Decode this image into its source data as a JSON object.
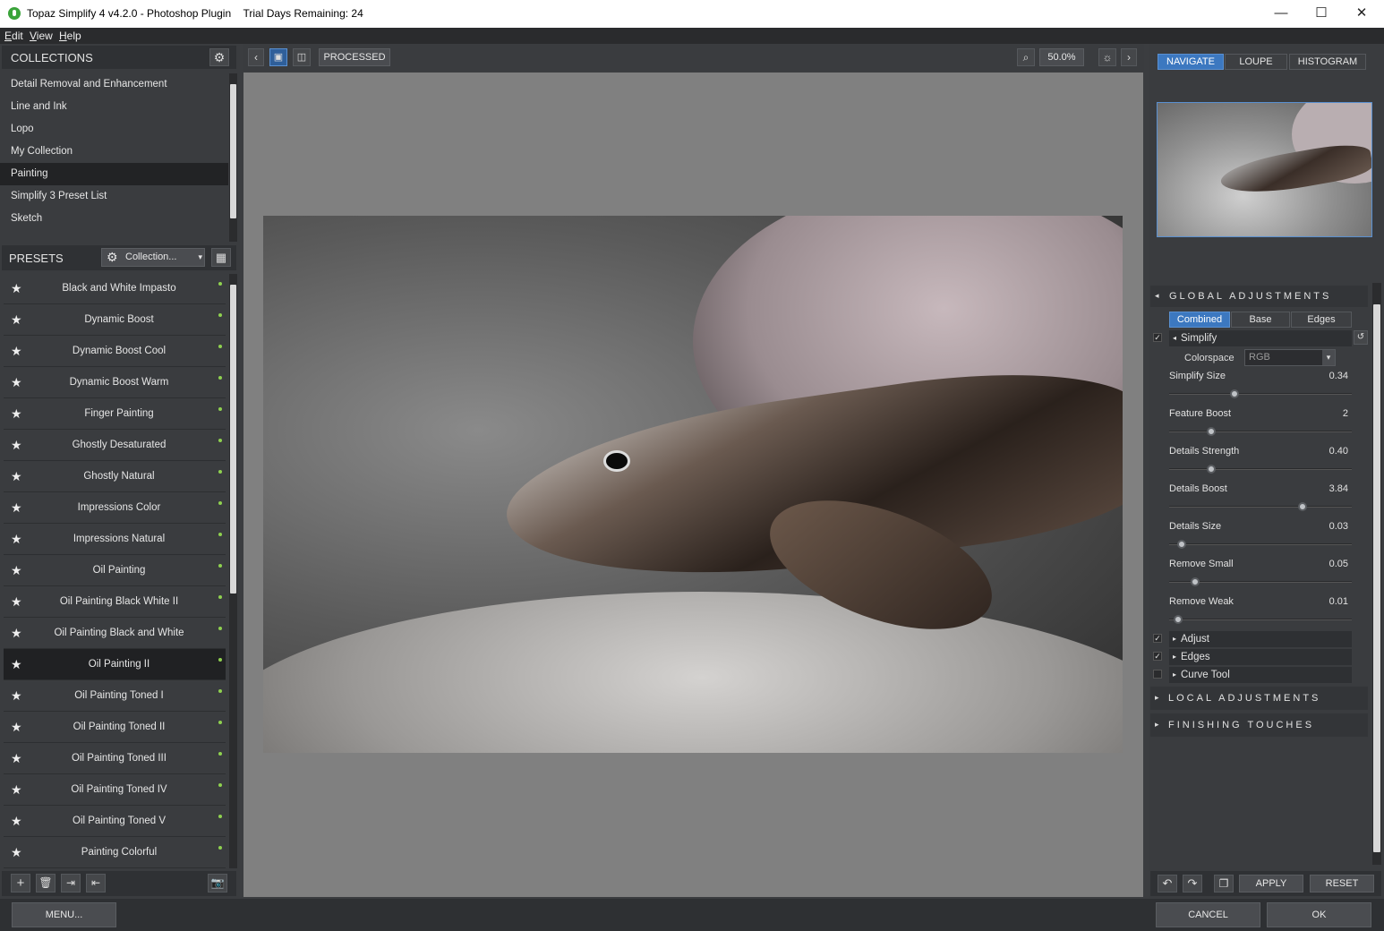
{
  "window": {
    "title": "Topaz Simplify 4 v4.2.0 - Photoshop Plugin",
    "trial": "Trial Days Remaining: 24",
    "minimize": "—",
    "maximize": "☐",
    "close": "✕"
  },
  "menu": [
    "Edit",
    "View",
    "Help"
  ],
  "collections": {
    "header": "COLLECTIONS",
    "items": [
      "Detail Removal and Enhancement",
      "Line and Ink",
      "Lopo",
      "My Collection",
      "Painting",
      "Simplify 3 Preset List",
      "Sketch"
    ],
    "selected": "Painting"
  },
  "presets": {
    "header": "PRESETS",
    "dropdown": "Collection...",
    "items": [
      "Black and White Impasto",
      "Dynamic Boost",
      "Dynamic Boost Cool",
      "Dynamic Boost Warm",
      "Finger Painting",
      "Ghostly Desaturated",
      "Ghostly Natural",
      "Impressions Color",
      "Impressions Natural",
      "Oil Painting",
      "Oil Painting Black White II",
      "Oil Painting Black and White",
      "Oil Painting II",
      "Oil Painting Toned I",
      "Oil Painting Toned II",
      "Oil Painting Toned III",
      "Oil Painting Toned IV",
      "Oil Painting Toned V",
      "Painting Colorful"
    ],
    "selected": "Oil Painting II"
  },
  "toolbar": {
    "view_mode": "PROCESSED",
    "zoom": "50.0%"
  },
  "right_tabs": [
    "NAVIGATE",
    "LOUPE",
    "HISTOGRAM"
  ],
  "global": {
    "header": "GLOBAL ADJUSTMENTS",
    "tabs": [
      "Combined",
      "Base",
      "Edges"
    ],
    "simplify_label": "Simplify",
    "colorspace_label": "Colorspace",
    "colorspace_value": "RGB",
    "sliders": [
      {
        "label": "Simplify Size",
        "value": "0.34",
        "fraction": 0.36
      },
      {
        "label": "Feature Boost",
        "value": "2",
        "fraction": 0.23
      },
      {
        "label": "Details Strength",
        "value": "0.40",
        "fraction": 0.23
      },
      {
        "label": "Details Boost",
        "value": "3.84",
        "fraction": 0.73
      },
      {
        "label": "Details Size",
        "value": "0.03",
        "fraction": 0.07
      },
      {
        "label": "Remove Small",
        "value": "0.05",
        "fraction": 0.14
      },
      {
        "label": "Remove Weak",
        "value": "0.01",
        "fraction": 0.05
      }
    ],
    "subsections": [
      {
        "label": "Adjust",
        "checked": true
      },
      {
        "label": "Edges",
        "checked": true
      },
      {
        "label": "Curve Tool",
        "checked": false
      }
    ]
  },
  "local_header": "LOCAL ADJUSTMENTS",
  "finishing_header": "FINISHING TOUCHES",
  "actions": {
    "apply": "APPLY",
    "reset": "RESET",
    "menu": "MENU...",
    "cancel": "CANCEL",
    "ok": "OK"
  },
  "colors": {
    "accent": "#3c78c0",
    "panel": "#3a3c3f",
    "canvas": "#808080"
  }
}
